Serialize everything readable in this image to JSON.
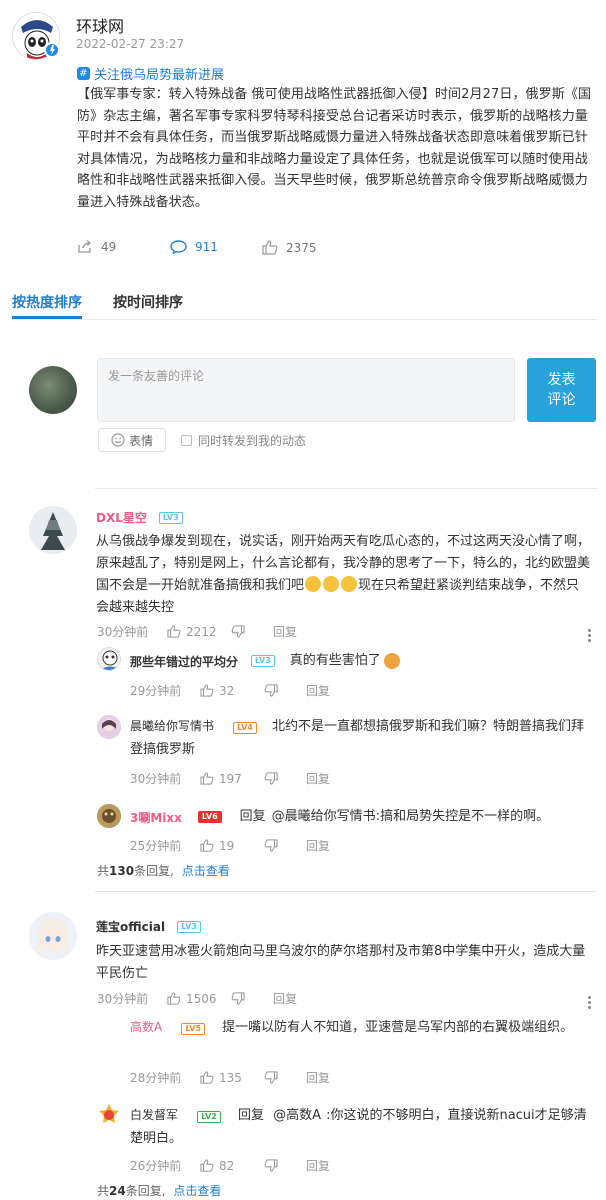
{
  "post": {
    "author": "环球网",
    "time": "2022-02-27 23:27",
    "topic": "关注俄乌局势最新进展",
    "text": "【俄军事专家：转入特殊战备 俄可使用战略性武器抵御入侵】时间2月27日，俄罗斯《国防》杂志主编，著名军事专家科罗特琴科接受总台记者采访时表示，俄罗斯的战略核力量平时并不会有具体任务，而当俄罗斯战略威慑力量进入特殊战备状态即意味着俄罗斯已针对具体情况，为战略核力量和非战略力量设定了具体任务，也就是说俄军可以随时使用战略性和非战略性武器来抵御入侵。当天早些时候，俄罗斯总统普京命令俄罗斯战略威慑力量进入特殊战备状态。",
    "stats": {
      "reposts": "49",
      "comments": "911",
      "likes": "2375"
    }
  },
  "tabs": {
    "hot": "按热度排序",
    "time": "按时间排序"
  },
  "compose": {
    "placeholder": "发一条友善的评论",
    "send_label": "发表\n评论",
    "emoji_label": "表情",
    "forward_label": "同时转发到我的动态"
  },
  "labels": {
    "reply_label": "回复",
    "reply_verb": "回复",
    "summary_total": "共",
    "summary_suffix": "条回复,",
    "summary_link": "点击查看"
  },
  "comments": [
    {
      "user": "DXL星空",
      "level": "LV3",
      "user_color": "#f05a85",
      "text_a": "从乌俄战争爆发到现在，说实话，刚开始两天有吃瓜心态的，不过这两天没心情了啊，原来越乱了，特别是网上，什么言论都有，我冷静的思考了一下，特么的，北约欧盟美国不会是一开始就准备搞俄和我们吧",
      "text_b": "现在只希望赶紧谈判结束战争，不然只会越来越失控",
      "time": "30分钟前",
      "likes": "2212",
      "replies": [
        {
          "user": "那些年错过的平均分",
          "level": "LV3",
          "text": "真的有些害怕了",
          "time": "29分钟前",
          "likes": "32"
        },
        {
          "user": "晨曦给你写情书",
          "level": "LV4",
          "text": "北约不是一直都想搞俄罗斯和我们嘛？特朗普搞我们拜登搞俄罗斯",
          "time": "30分钟前",
          "likes": "197"
        },
        {
          "user": "3唰Mixx",
          "level": "LV6",
          "reply_to": "@晨曦给你写情书",
          "text": ":搞和局势失控是不一样的啊。",
          "time": "25分钟前",
          "likes": "19"
        }
      ],
      "reply_count": "130"
    },
    {
      "user": "莲宝official",
      "level": "LV3",
      "user_color": "#333333",
      "text": "昨天亚速营用冰雹火箭炮向马里乌波尔的萨尔塔那村及市第8中学集中开火，造成大量平民伤亡",
      "time": "30分钟前",
      "likes": "1506",
      "replies": [
        {
          "user": "高数A",
          "level": "LV5",
          "text": "提一嘴以防有人不知道，亚速营是乌军内部的右翼极端组织。",
          "time": "28分钟前",
          "likes": "135"
        },
        {
          "user": "白发督军",
          "level": "LV2",
          "reply_to": "@高数A",
          "text": ":你这说的不够明白，直接说新nacui才足够清楚明白。",
          "time": "26分钟前",
          "likes": "82"
        }
      ],
      "reply_count": "24"
    }
  ],
  "colors": {
    "accent": "#1f7fd0",
    "send_button": "#29a2dc"
  }
}
